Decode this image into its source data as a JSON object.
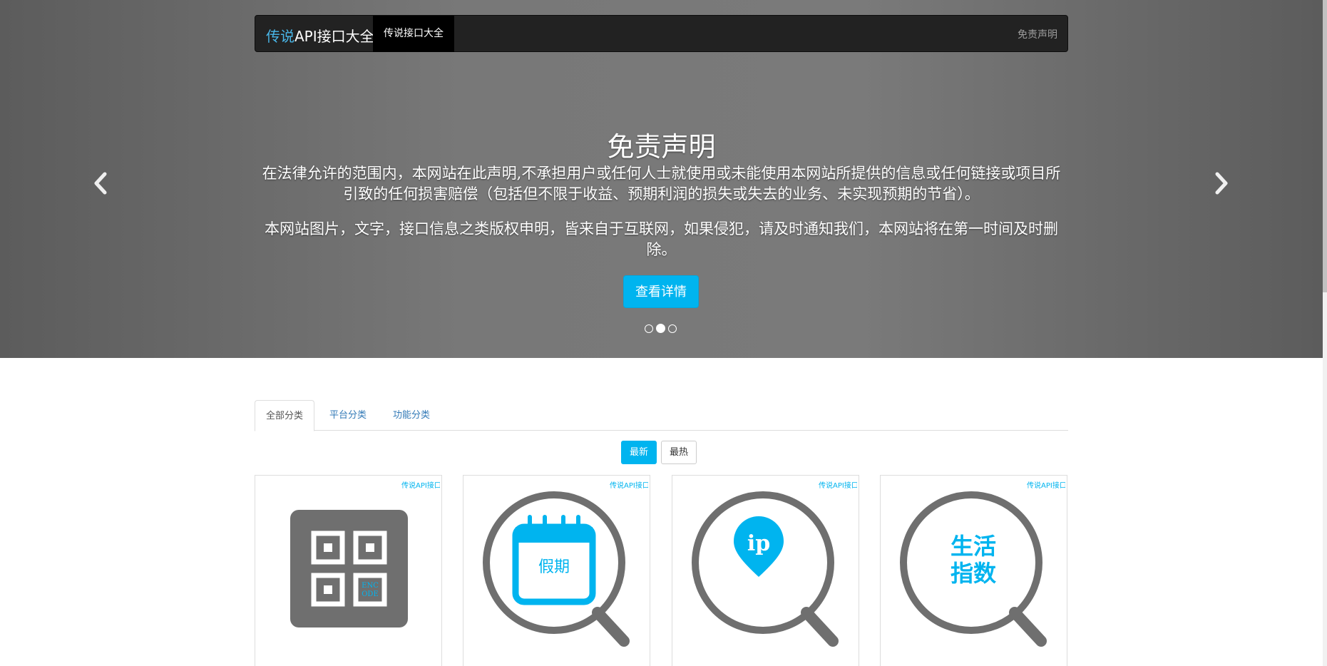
{
  "navbar": {
    "brand_prefix": "传说",
    "brand_suffix": "API接口大全",
    "active_tab": "传说接口大全",
    "right_link": "免责声明"
  },
  "carousel": {
    "title": "免责声明",
    "paragraph1": "在法律允许的范围内，本网站在此声明,不承担用户或任何人士就使用或未能使用本网站所提供的信息或任何链接或项目所引致的任何损害赔偿（包括但不限于收益、预期利润的损失或失去的业务、未实现预期的节省）。",
    "paragraph2": "本网站图片，文字，接口信息之类版权申明，皆来自于互联网，如果侵犯，请及时通知我们，本网站将在第一时间及时删除。",
    "button": "查看详情",
    "slide_count": 3,
    "active_slide": 2
  },
  "tabs": [
    {
      "label": "全部分类"
    },
    {
      "label": "平台分类"
    },
    {
      "label": "功能分类"
    }
  ],
  "sort": {
    "newest": "最新",
    "hottest": "最热"
  },
  "cards": [
    {
      "tag": "传说API接口",
      "icon": "qr-encode-icon",
      "icon_text": "ENCODE"
    },
    {
      "tag": "传说API接口",
      "icon": "holiday-calendar-icon",
      "icon_text": "假期"
    },
    {
      "tag": "传说API接口",
      "icon": "ip-location-icon",
      "icon_text": "ip"
    },
    {
      "tag": "传说API接口",
      "icon": "life-index-icon",
      "icon_text": "生活\n指数"
    }
  ],
  "colors": {
    "accent": "#00b4ef",
    "navbar": "#222222",
    "icon_gray": "#6f6f6f"
  }
}
